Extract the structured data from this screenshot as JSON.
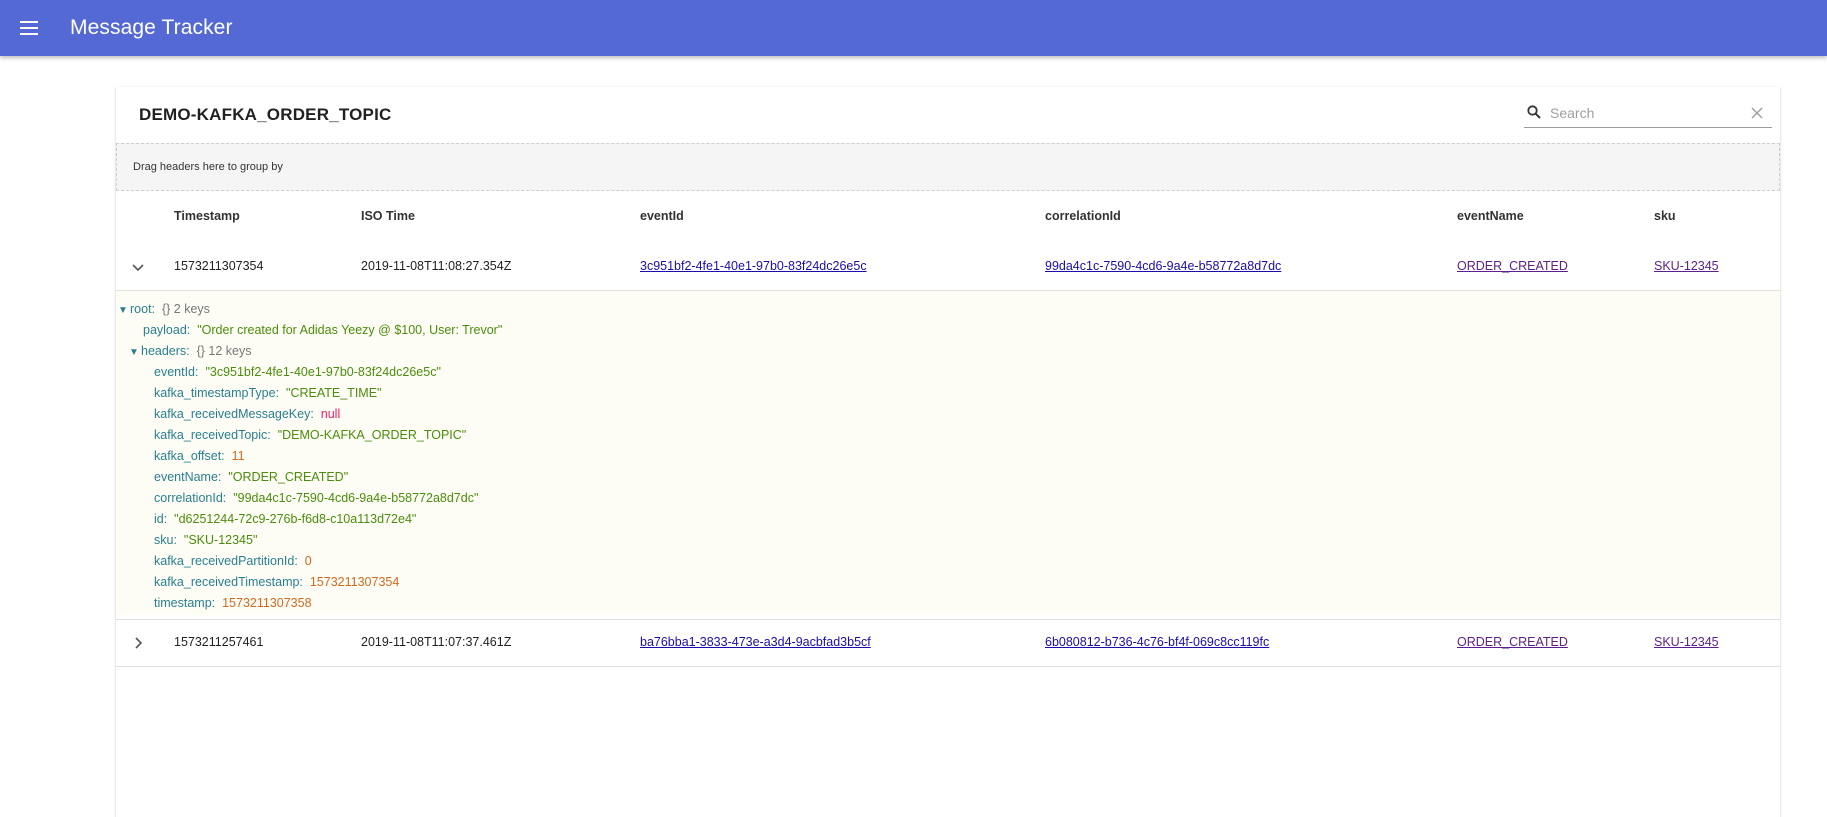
{
  "app": {
    "title": "Message Tracker"
  },
  "card": {
    "title": "DEMO-KAFKA_ORDER_TOPIC"
  },
  "search": {
    "placeholder": "Search",
    "value": ""
  },
  "grouping": {
    "text": "Drag headers here to group by"
  },
  "table": {
    "headers": [
      "Timestamp",
      "ISO Time",
      "eventId",
      "correlationId",
      "eventName",
      "sku"
    ],
    "rows": [
      {
        "timestamp": "1573211307354",
        "iso_time": "2019-11-08T11:08:27.354Z",
        "eventId": "3c951bf2-4fe1-40e1-97b0-83f24dc26e5c",
        "correlationId": "99da4c1c-7590-4cd6-9a4e-b58772a8d7dc",
        "eventName": "ORDER_CREATED",
        "sku": "SKU-12345",
        "expanded": true
      },
      {
        "timestamp": "1573211257461",
        "iso_time": "2019-11-08T11:07:37.461Z",
        "eventId": "ba76bba1-3833-473e-a3d4-9acbfad3b5cf",
        "correlationId": "6b080812-b736-4c76-bf4f-069c8cc119fc",
        "eventName": "ORDER_CREATED",
        "sku": "SKU-12345",
        "expanded": false
      }
    ]
  },
  "json_view": {
    "root_key": "root:",
    "root_meta": "{}  2 keys",
    "payload_key": "payload:",
    "payload_val": "\"Order created for Adidas Yeezy @ $100, User: Trevor\"",
    "headers_key": "headers:",
    "headers_meta": "{}  12 keys",
    "fields": [
      {
        "key": "eventId:",
        "value": "\"3c951bf2-4fe1-40e1-97b0-83f24dc26e5c\"",
        "kind": "str"
      },
      {
        "key": "kafka_timestampType:",
        "value": "\"CREATE_TIME\"",
        "kind": "str"
      },
      {
        "key": "kafka_receivedMessageKey:",
        "value": "null",
        "kind": "null"
      },
      {
        "key": "kafka_receivedTopic:",
        "value": "\"DEMO-KAFKA_ORDER_TOPIC\"",
        "kind": "str"
      },
      {
        "key": "kafka_offset:",
        "value": "11",
        "kind": "num"
      },
      {
        "key": "eventName:",
        "value": "\"ORDER_CREATED\"",
        "kind": "str"
      },
      {
        "key": "correlationId:",
        "value": "\"99da4c1c-7590-4cd6-9a4e-b58772a8d7dc\"",
        "kind": "str"
      },
      {
        "key": "id:",
        "value": "\"d6251244-72c9-276b-f6d8-c10a113d72e4\"",
        "kind": "str"
      },
      {
        "key": "sku:",
        "value": "\"SKU-12345\"",
        "kind": "str"
      },
      {
        "key": "kafka_receivedPartitionId:",
        "value": "0",
        "kind": "num"
      },
      {
        "key": "kafka_receivedTimestamp:",
        "value": "1573211307354",
        "kind": "num"
      },
      {
        "key": "timestamp:",
        "value": "1573211307358",
        "kind": "num"
      }
    ]
  },
  "icons": [
    "menu-icon",
    "search-icon",
    "close-icon",
    "chevron-down-icon",
    "chevron-right-icon",
    "triangle-down-icon"
  ],
  "colors": {
    "appbar": "#5469d4",
    "json_key": "#2a7f8f",
    "json_string": "#4b8d0a",
    "json_number": "#d2691e",
    "json_null": "#e91e63"
  }
}
